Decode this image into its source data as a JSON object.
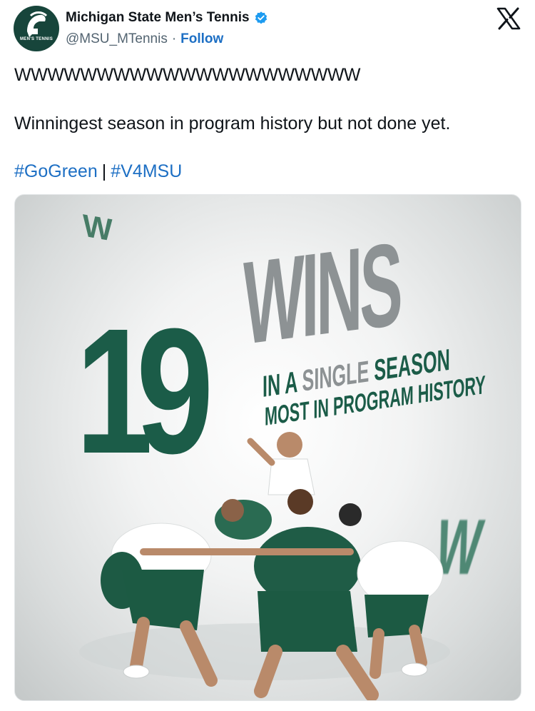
{
  "account": {
    "display_name": "Michigan State Men’s Tennis",
    "handle": "@MSU_MTennis",
    "separator": "·",
    "follow_label": "Follow",
    "avatar_text": "MEN'S TENNIS",
    "verified": true
  },
  "tweet": {
    "line1": "WWWWWWWWWWWWWWWWWWWWW",
    "line2": "Winningest season in program history but not done yet.",
    "hashtags": [
      "#GoGreen",
      "#V4MSU"
    ],
    "hashtag_separator": "|"
  },
  "media": {
    "number": "19",
    "headline": "WINS",
    "subline_first": "IN A ",
    "subline_mid": "SINGLE",
    "subline_last": " SEASON",
    "subline2": "MOST IN PROGRAM HISTORY",
    "small_w": "W",
    "blur_w": "W",
    "colors": {
      "green": "#1b5c48",
      "grey": "#8d9294"
    }
  },
  "icons": {
    "platform": "x-logo-icon",
    "verified": "verified-badge-icon",
    "avatar": "spartan-helmet-icon"
  },
  "colors": {
    "link": "#1d6fc4",
    "handle": "#536471",
    "text": "#0f1419"
  }
}
